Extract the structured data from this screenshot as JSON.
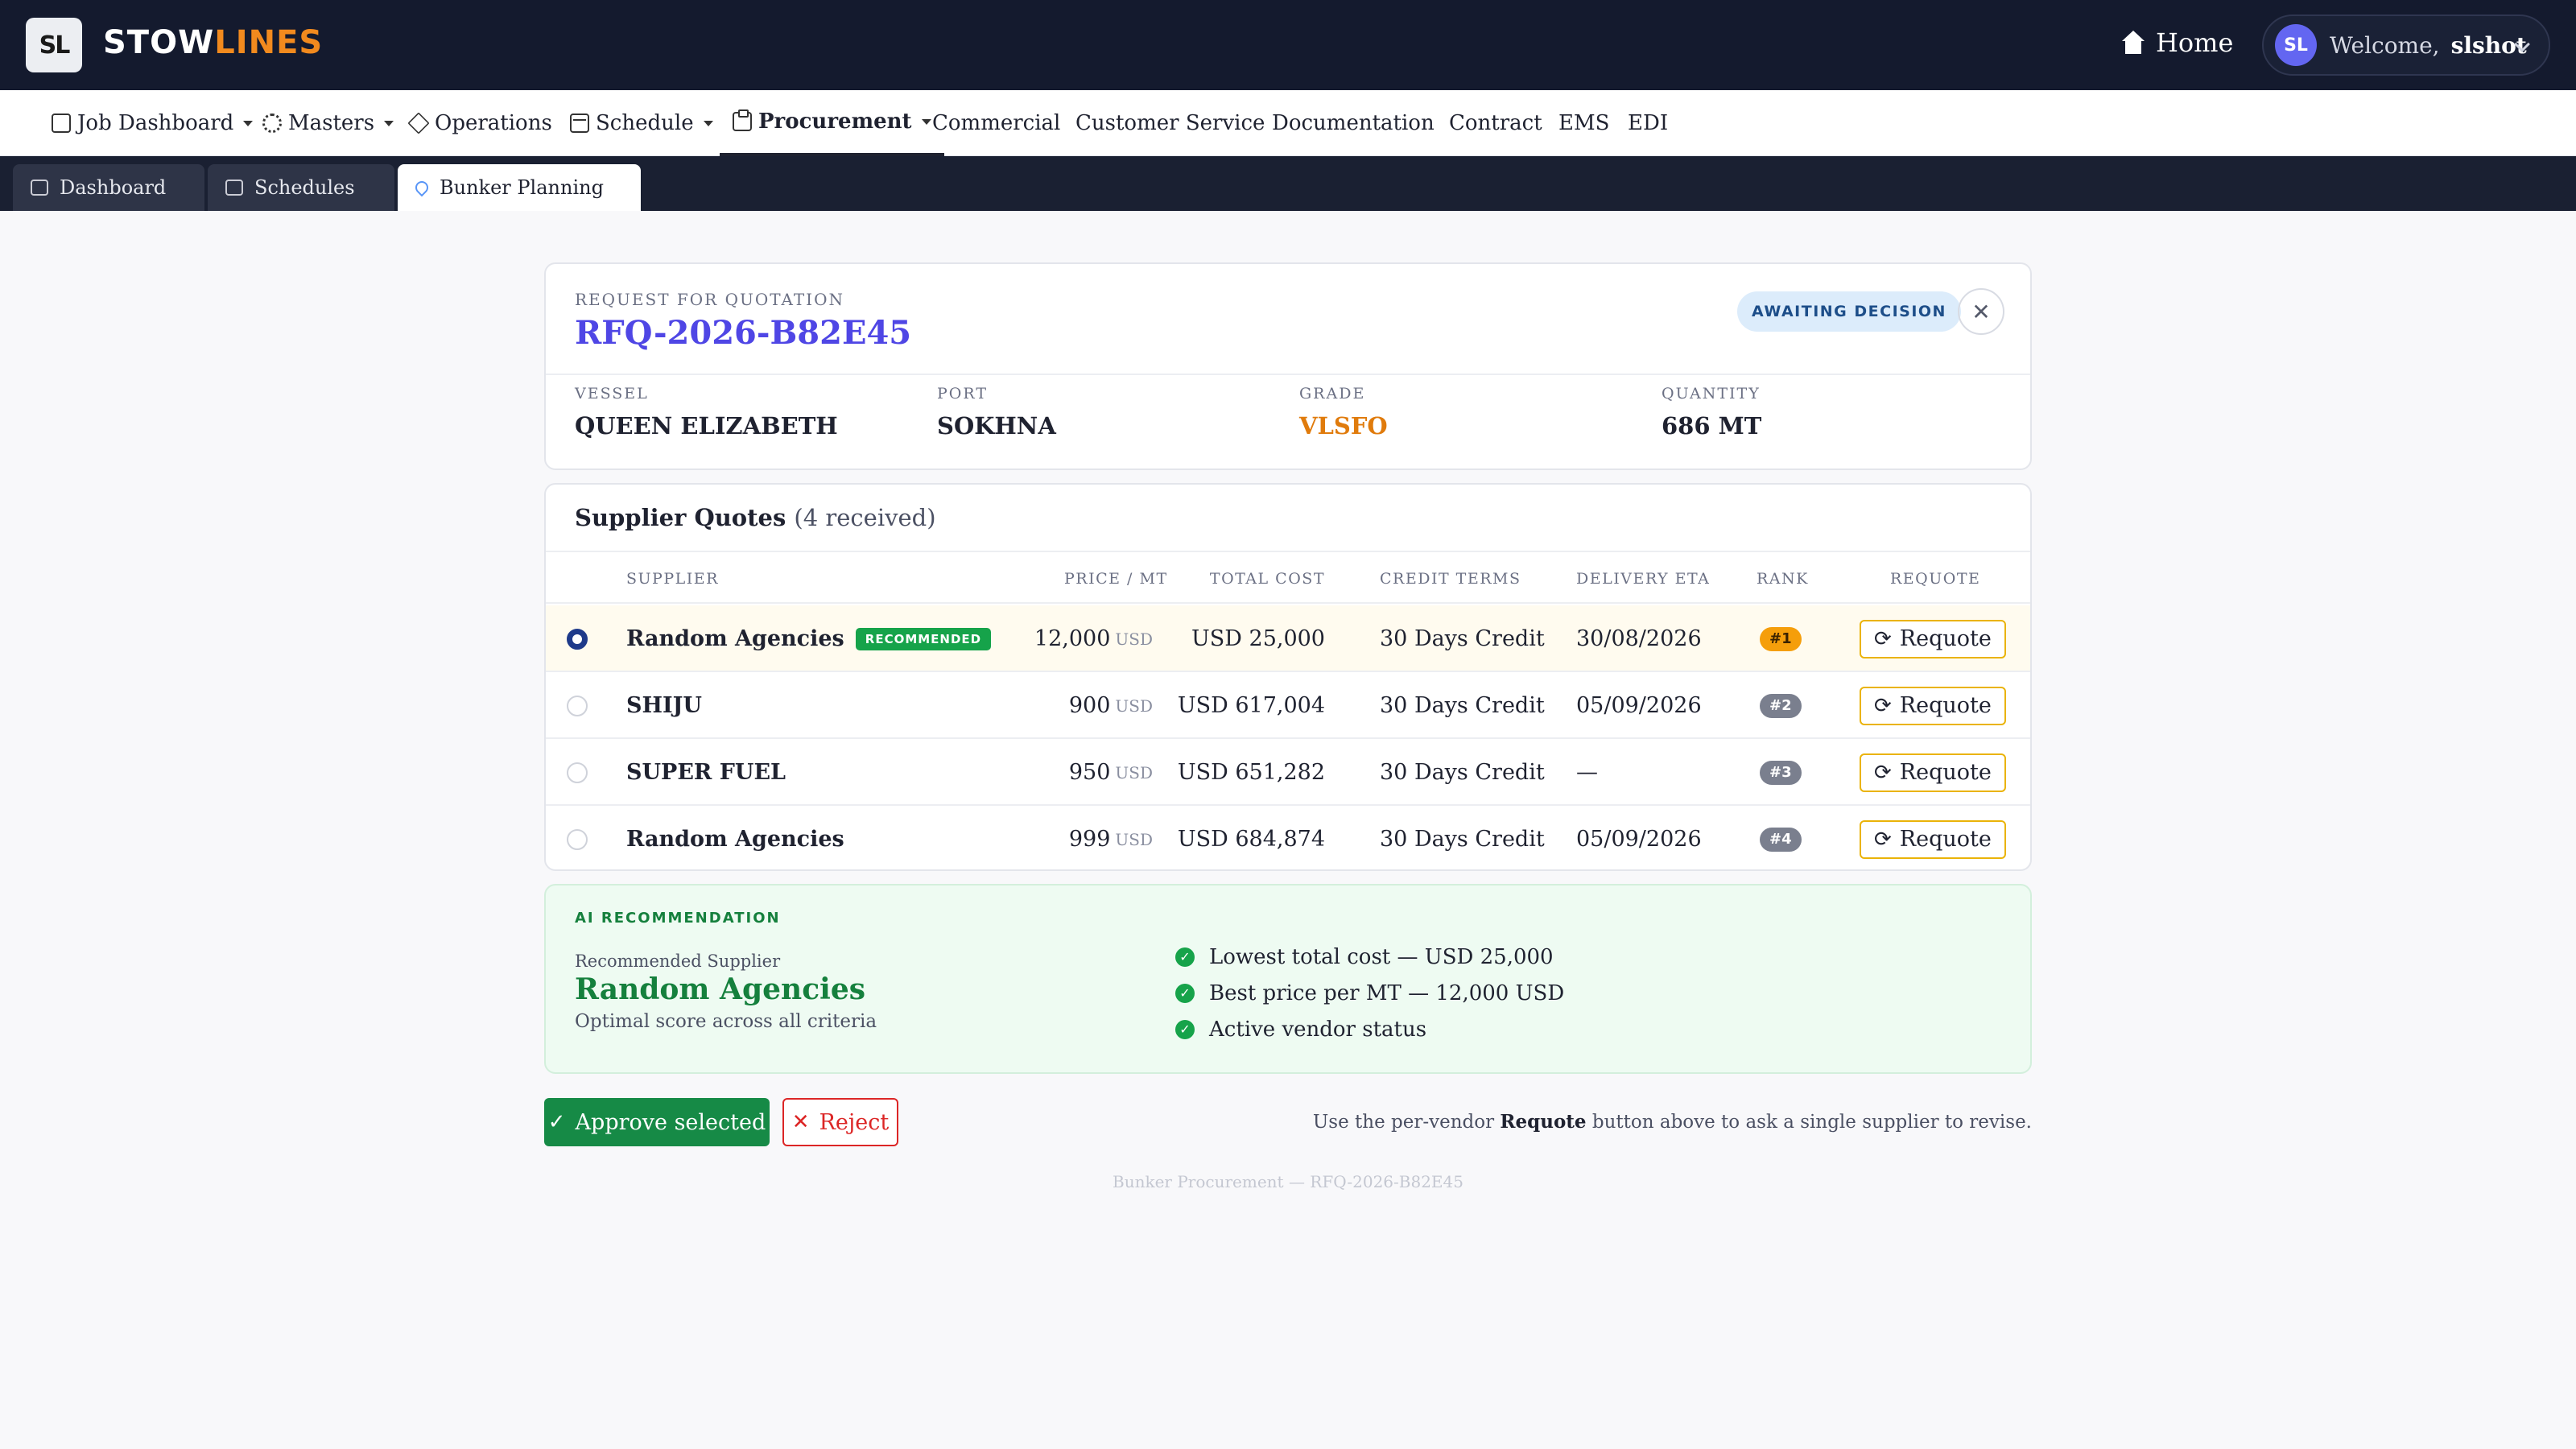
{
  "app": {
    "logo_text": "SL",
    "brand_part1": "STOW",
    "brand_part2": "LINES"
  },
  "header": {
    "home_label": "Home",
    "avatar_initials": "SL",
    "welcome_label": "Welcome,",
    "username": "slshot"
  },
  "nav": {
    "items": [
      {
        "label": "Job Dashboard",
        "icon": "dashboard-icon",
        "dropdown": true
      },
      {
        "label": "Masters",
        "icon": "gear-icon",
        "dropdown": true
      },
      {
        "label": "Operations",
        "icon": "cube-icon",
        "dropdown": false
      },
      {
        "label": "Schedule",
        "icon": "calendar-icon",
        "dropdown": true
      },
      {
        "label": "Procurement",
        "icon": "clipboard-icon",
        "dropdown": true,
        "active": true
      },
      {
        "label": "Commercial"
      },
      {
        "label": "Customer Service"
      },
      {
        "label": "Documentation"
      },
      {
        "label": "Contract"
      },
      {
        "label": "EMS"
      },
      {
        "label": "EDI"
      }
    ]
  },
  "tabs": [
    {
      "label": "Dashboard",
      "icon": "gauge-icon"
    },
    {
      "label": "Schedules",
      "icon": "calendar-icon"
    },
    {
      "label": "Bunker Planning",
      "icon": "droplet-icon",
      "active": true
    }
  ],
  "rfq": {
    "eyebrow": "REQUEST FOR QUOTATION",
    "id": "RFQ-2026-B82E45",
    "status": "AWAITING DECISION",
    "close_symbol": "✕",
    "meta": [
      {
        "label": "VESSEL",
        "value": "QUEEN ELIZABETH"
      },
      {
        "label": "PORT",
        "value": "SOKHNA"
      },
      {
        "label": "GRADE",
        "value": "VLSFO",
        "accent": "#e07b0c"
      },
      {
        "label": "QUANTITY",
        "value": "686 MT"
      }
    ]
  },
  "quotes": {
    "title": "Supplier Quotes",
    "count_label": "(4 received)",
    "columns": [
      "SUPPLIER",
      "PRICE / MT",
      "TOTAL COST",
      "CREDIT TERMS",
      "DELIVERY ETA",
      "RANK",
      "REQUOTE"
    ],
    "recommended_label": "RECOMMENDED",
    "requote_label": "Requote",
    "rows": [
      {
        "supplier": "Random Agencies",
        "recommended": true,
        "price": "12,000",
        "unit": "USD",
        "total": "USD 25,000",
        "credit": "30 Days Credit",
        "eta": "30/08/2026",
        "rank": "#1",
        "selected": true
      },
      {
        "supplier": "SHIJU",
        "recommended": false,
        "price": "900",
        "unit": "USD",
        "total": "USD 617,004",
        "credit": "30 Days Credit",
        "eta": "05/09/2026",
        "rank": "#2",
        "selected": false
      },
      {
        "supplier": "SUPER FUEL",
        "recommended": false,
        "price": "950",
        "unit": "USD",
        "total": "USD 651,282",
        "credit": "30 Days Credit",
        "eta": "—",
        "rank": "#3",
        "selected": false
      },
      {
        "supplier": "Random Agencies",
        "recommended": false,
        "price": "999",
        "unit": "USD",
        "total": "USD 684,874",
        "credit": "30 Days Credit",
        "eta": "05/09/2026",
        "rank": "#4",
        "selected": false
      }
    ]
  },
  "ai": {
    "eyebrow": "AI RECOMMENDATION",
    "sub_label": "Recommended Supplier",
    "supplier": "Random Agencies",
    "description": "Optimal score across all criteria",
    "reasons": [
      "Lowest total cost — USD 25,000",
      "Best price per MT — 12,000 USD",
      "Active vendor status"
    ]
  },
  "actions": {
    "approve_label": "Approve selected",
    "reject_label": "Reject",
    "hint_prefix": "Use the per-vendor",
    "hint_bold": "Requote",
    "hint_suffix": "button above to ask a single supplier to revise."
  },
  "footer": {
    "text": "Bunker Procurement — RFQ-2026-B82E45"
  },
  "colors": {
    "accent": "#4f46e5",
    "success": "#168a46",
    "danger": "#dc2626",
    "warning": "#eab308",
    "topbar": "#141a2e"
  }
}
